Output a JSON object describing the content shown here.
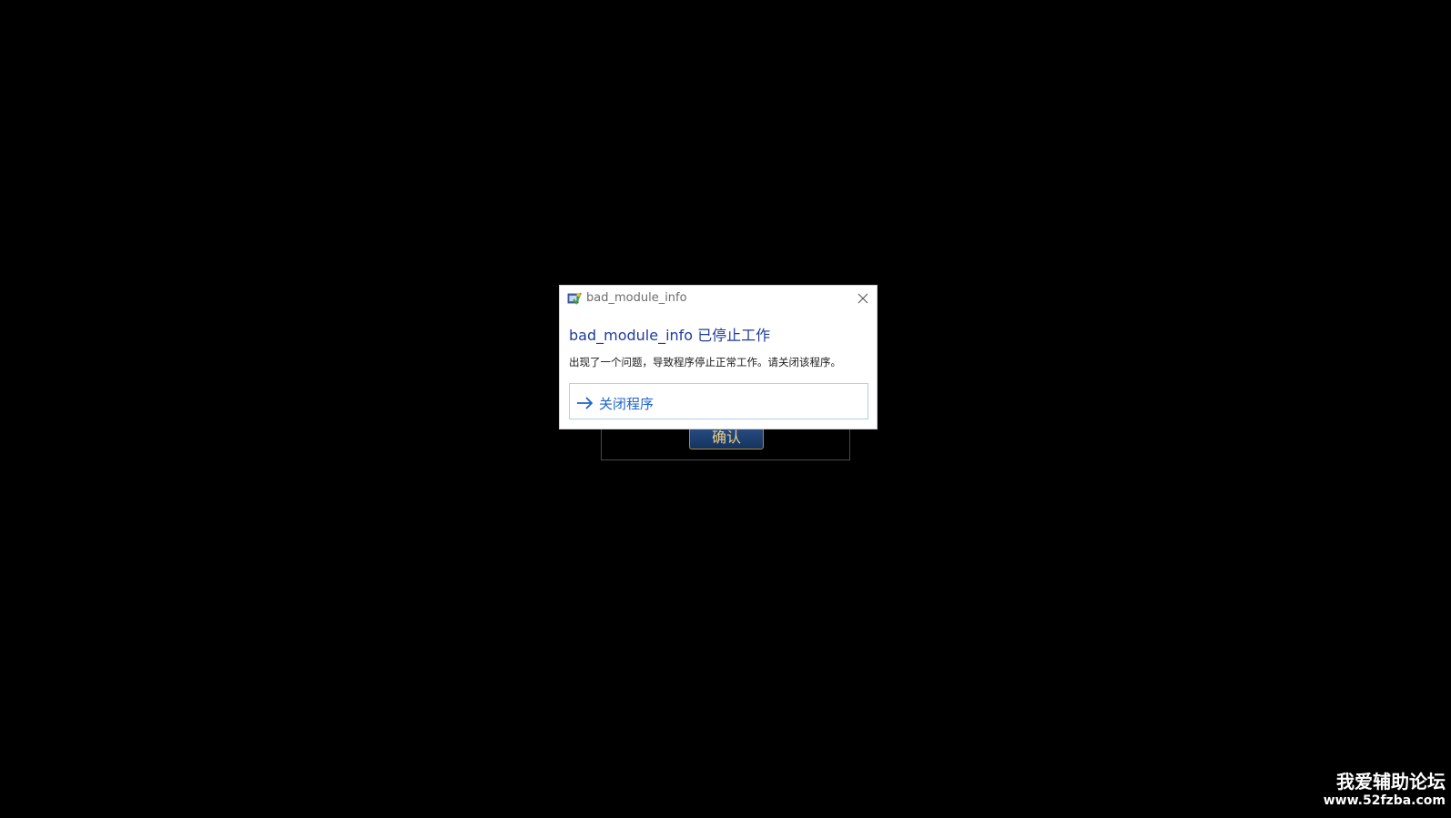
{
  "background_game": {
    "confirm_label": "确认"
  },
  "dialog": {
    "window_title": "bad_module_info",
    "app_icon": "application-icon",
    "close_icon": "close-icon",
    "heading": "bad_module_info 已停止工作",
    "message": "出现了一个问题，导致程序停止正常工作。请关闭该程序。",
    "action_label": "关闭程序",
    "action_icon": "arrow-right-icon",
    "colors": {
      "heading": "#1e3c9e",
      "action": "#1f63c9"
    }
  },
  "watermark": {
    "title": "我爱辅助论坛",
    "url": "www.52fzba.com"
  }
}
